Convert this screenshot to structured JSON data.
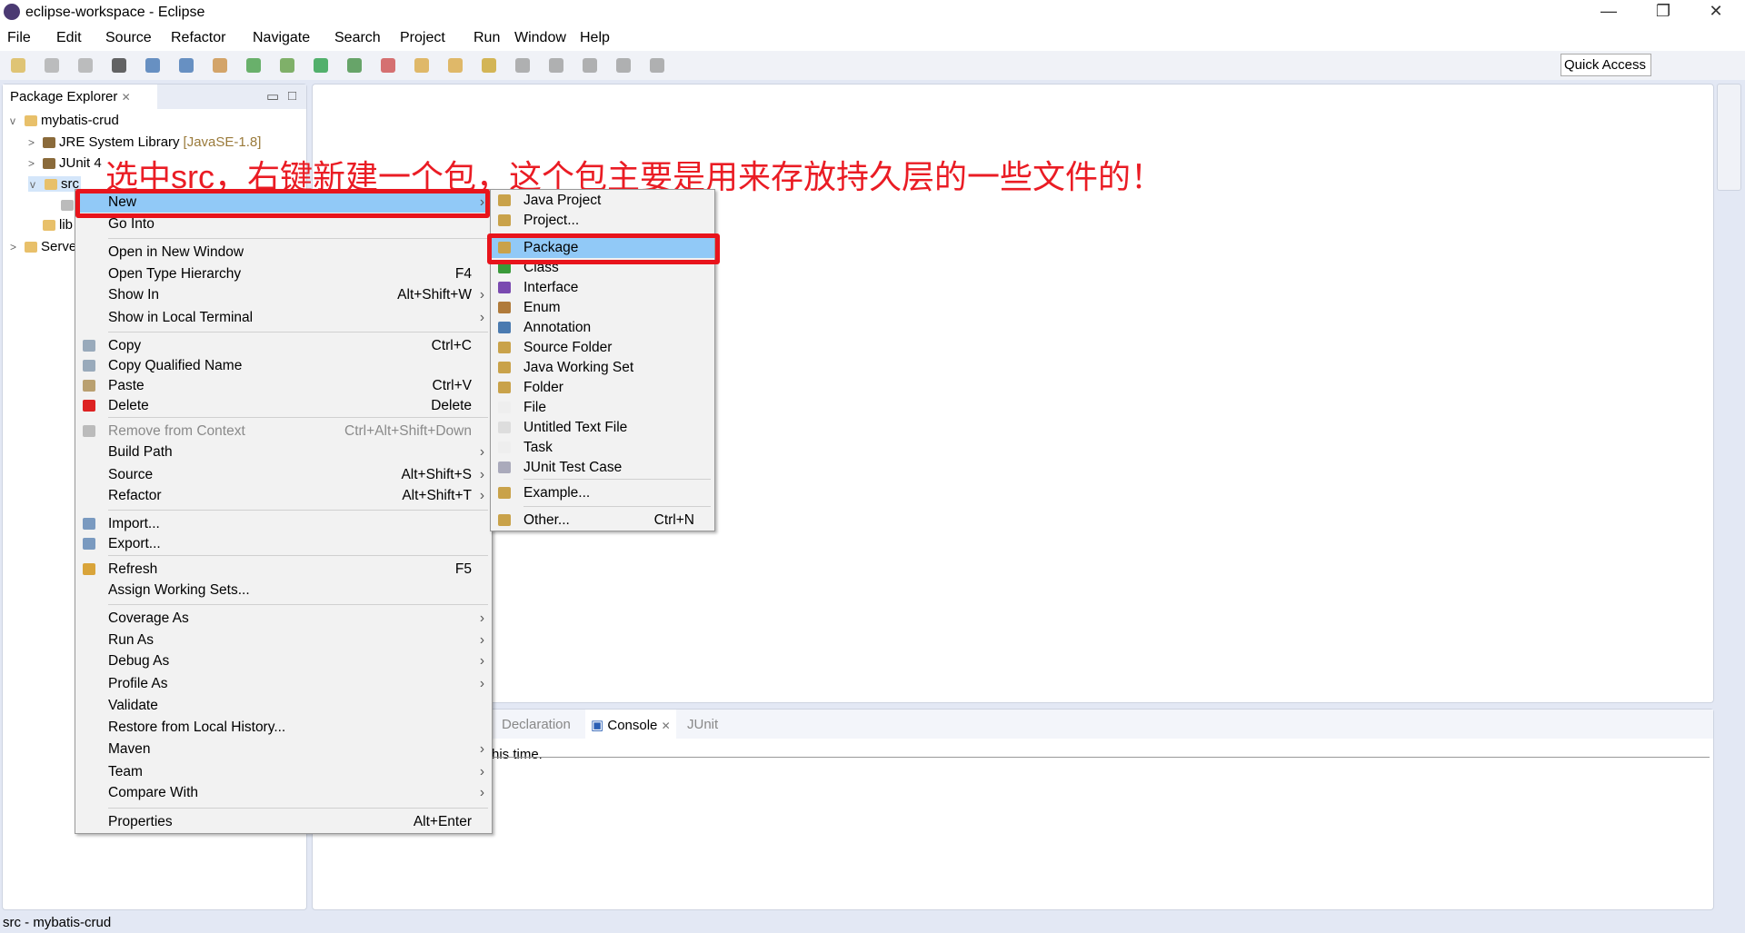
{
  "window": {
    "title": "eclipse-workspace - Eclipse",
    "minimize": "—",
    "restore": "❐",
    "close": "✕"
  },
  "menubar": [
    "File",
    "Edit",
    "Source",
    "Refactor",
    "Navigate",
    "Search",
    "Project",
    "Run",
    "Window",
    "Help"
  ],
  "toolbar": {
    "quick_access": "Quick Access"
  },
  "package_explorer": {
    "tab": "Package Explorer",
    "tree": [
      {
        "label": "mybatis-crud",
        "extra": "",
        "twisty": "v",
        "indent": 0,
        "icon": "project-icon"
      },
      {
        "label": "JRE System Library",
        "extra": "[JavaSE-1.8]",
        "twisty": ">",
        "indent": 1,
        "icon": "library-icon"
      },
      {
        "label": "JUnit 4",
        "extra": "",
        "twisty": ">",
        "indent": 1,
        "icon": "library-icon"
      },
      {
        "label": "src",
        "extra": "",
        "twisty": "v",
        "indent": 1,
        "icon": "source-folder-icon",
        "selected": true
      },
      {
        "label": "",
        "extra": "",
        "twisty": "",
        "indent": 2,
        "icon": "package-icon"
      },
      {
        "label": "lib",
        "extra": "",
        "twisty": "",
        "indent": 1,
        "icon": "folder-icon"
      },
      {
        "label": "Serve",
        "extra": "",
        "twisty": ">",
        "indent": 0,
        "icon": "project-icon"
      }
    ]
  },
  "context_menu": [
    {
      "label": "New",
      "accel": "",
      "sub": true,
      "highlight": true
    },
    {
      "label": "Go Into"
    },
    {
      "sep": true
    },
    {
      "label": "Open in New Window"
    },
    {
      "label": "Open Type Hierarchy",
      "accel": "F4"
    },
    {
      "label": "Show In",
      "accel": "Alt+Shift+W",
      "sub": true
    },
    {
      "label": "Show in Local Terminal",
      "sub": true
    },
    {
      "sep": true
    },
    {
      "label": "Copy",
      "accel": "Ctrl+C",
      "icon": "copy-icon"
    },
    {
      "label": "Copy Qualified Name",
      "icon": "copy-icon"
    },
    {
      "label": "Paste",
      "accel": "Ctrl+V",
      "icon": "paste-icon"
    },
    {
      "label": "Delete",
      "accel": "Delete",
      "icon": "delete-icon"
    },
    {
      "sep": true
    },
    {
      "label": "Remove from Context",
      "accel": "Ctrl+Alt+Shift+Down",
      "disabled": true,
      "icon": "remove-icon"
    },
    {
      "label": "Build Path",
      "sub": true
    },
    {
      "label": "Source",
      "accel": "Alt+Shift+S",
      "sub": true
    },
    {
      "label": "Refactor",
      "accel": "Alt+Shift+T",
      "sub": true
    },
    {
      "sep": true
    },
    {
      "label": "Import...",
      "icon": "import-icon"
    },
    {
      "label": "Export...",
      "icon": "export-icon"
    },
    {
      "sep": true
    },
    {
      "label": "Refresh",
      "accel": "F5",
      "icon": "refresh-icon"
    },
    {
      "label": "Assign Working Sets..."
    },
    {
      "sep": true
    },
    {
      "label": "Coverage As",
      "sub": true
    },
    {
      "label": "Run As",
      "sub": true
    },
    {
      "label": "Debug As",
      "sub": true
    },
    {
      "label": "Profile As",
      "sub": true
    },
    {
      "label": "Validate"
    },
    {
      "label": "Restore from Local History..."
    },
    {
      "label": "Maven",
      "sub": true
    },
    {
      "label": "Team",
      "sub": true
    },
    {
      "label": "Compare With",
      "sub": true
    },
    {
      "sep": true
    },
    {
      "label": "Properties",
      "accel": "Alt+Enter"
    }
  ],
  "new_submenu": [
    {
      "label": "Java Project",
      "icon": "java-project-icon"
    },
    {
      "label": "Project...",
      "icon": "project-wizard-icon"
    },
    {
      "sep": true
    },
    {
      "label": "Package",
      "icon": "package-icon",
      "highlight": true
    },
    {
      "label": "Class",
      "icon": "class-icon"
    },
    {
      "label": "Interface",
      "icon": "interface-icon"
    },
    {
      "label": "Enum",
      "icon": "enum-icon"
    },
    {
      "label": "Annotation",
      "icon": "annotation-icon"
    },
    {
      "label": "Source Folder",
      "icon": "source-folder-icon"
    },
    {
      "label": "Java Working Set",
      "icon": "working-set-icon"
    },
    {
      "label": "Folder",
      "icon": "folder-icon"
    },
    {
      "label": "File",
      "icon": "file-icon"
    },
    {
      "label": "Untitled Text File",
      "icon": "text-file-icon"
    },
    {
      "label": "Task",
      "icon": "task-icon"
    },
    {
      "label": "JUnit Test Case",
      "icon": "junit-icon"
    },
    {
      "sep": true
    },
    {
      "label": "Example...",
      "icon": "example-icon"
    },
    {
      "sep": true
    },
    {
      "label": "Other...",
      "accel": "Ctrl+N",
      "icon": "other-icon"
    }
  ],
  "annotation": "选中src，右键新建一个包，这个包主要是用来存放持久层的一些文件的！",
  "console": {
    "tabs": [
      "Declaration",
      "Console",
      "JUnit"
    ],
    "active": "Console",
    "text": "his time."
  },
  "status": "src - mybatis-crud",
  "colors": {
    "highlight": "#91c9f7",
    "annotation_red": "#e8141c",
    "background": "#e3e8f4"
  }
}
